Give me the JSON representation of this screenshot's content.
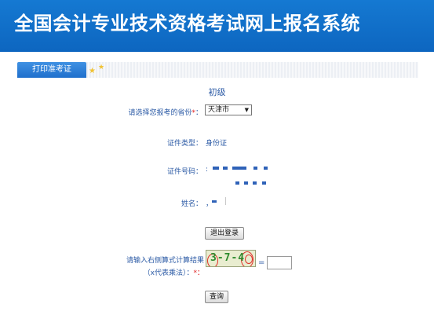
{
  "header": {
    "title": "全国会计专业技术资格考试网上报名系统"
  },
  "tabs": [
    {
      "label": "打印准考证"
    }
  ],
  "section": {
    "title": "初级"
  },
  "form": {
    "province_label": "请选择您报考的省份",
    "province_required": "*",
    "province_colon": "：",
    "province_value": "天津市",
    "id_type_label": "证件类型：",
    "id_type_value": "身份证",
    "id_number_label": "证件号码：",
    "name_label": "姓名：",
    "name_value": "，",
    "logout_label": "退出登录",
    "captcha_label_line1": "请输入右侧算式计算结果",
    "captcha_label_line2": "（x代表乘法）：",
    "captcha_required": "*：",
    "captcha_expression": "3-7-4",
    "equals": "=",
    "query_label": "查询"
  }
}
